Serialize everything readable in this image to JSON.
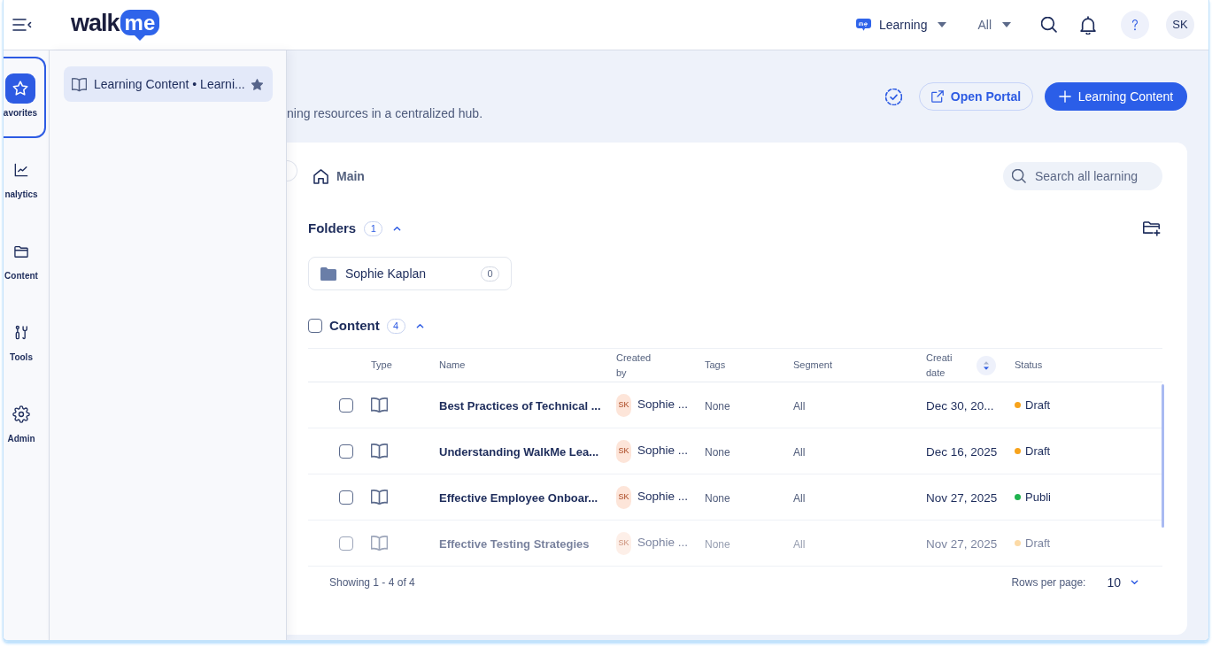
{
  "top_bar": {
    "logo": {
      "wordmark": "walk",
      "bubble": "me"
    },
    "product_menu": {
      "label": "Learning"
    },
    "scope_menu": {
      "label": "All"
    },
    "user": {
      "initials": "SK"
    }
  },
  "nav_rail": {
    "items": [
      {
        "label": "avorites",
        "selected": true
      },
      {
        "label": "nalytics",
        "selected": false
      },
      {
        "label": "Content",
        "selected": false
      },
      {
        "label": "Tools",
        "selected": false
      },
      {
        "label": "Admin",
        "selected": false
      }
    ]
  },
  "favorites_panel": {
    "items": [
      {
        "label": "Learning Content • Learni...",
        "starred": true
      }
    ]
  },
  "page_header": {
    "subtitle": "ning resources in a centralized hub.",
    "open_portal_button": "Open Portal",
    "create_button": "Learning Content"
  },
  "browser": {
    "breadcrumb": [
      {
        "label": "Main"
      }
    ],
    "search": {
      "placeholder": "Search all learning"
    },
    "folders": {
      "title": "Folders",
      "count": "1",
      "expanded": true,
      "items": [
        {
          "name": "Sophie Kaplan",
          "count": "0"
        }
      ]
    },
    "content": {
      "title": "Content",
      "count": "4",
      "expanded": true,
      "checked": false,
      "table": {
        "columns": [
          {
            "label": "Type",
            "sorted": false
          },
          {
            "label": "Name",
            "sorted": false
          },
          {
            "label": "Created by",
            "sorted": false
          },
          {
            "label": "Tags",
            "sorted": false
          },
          {
            "label": "Segment",
            "sorted": false
          },
          {
            "label": "Creati date",
            "sorted": true
          },
          {
            "label": "Status",
            "sorted": false
          }
        ],
        "rows": [
          {
            "checked": false,
            "name": "Best Practices of Technical ...",
            "creator": {
              "initials": "SK",
              "name": "Sophie ..."
            },
            "tags": "None",
            "segment": "All",
            "created": "Dec 30, 20...",
            "status": {
              "label": "Draft",
              "color": "#f7a31c"
            }
          },
          {
            "checked": false,
            "name": "Understanding WalkMe Lea...",
            "creator": {
              "initials": "SK",
              "name": "Sophie ..."
            },
            "tags": "None",
            "segment": "All",
            "created": "Dec 16, 2025",
            "status": {
              "label": "Draft",
              "color": "#f7a31c"
            }
          },
          {
            "checked": false,
            "name": "Effective Employee Onboar...",
            "creator": {
              "initials": "SK",
              "name": "Sophie ..."
            },
            "tags": "None",
            "segment": "All",
            "created": "Nov 27, 2025",
            "status": {
              "label": "Publi",
              "color": "#1fb34f"
            }
          },
          {
            "checked": false,
            "name": "Effective Testing Strategies",
            "creator": {
              "initials": "SK",
              "name": "Sophie ..."
            },
            "tags": "None",
            "segment": "All",
            "created": "Nov 27, 2025",
            "status": {
              "label": "Draft",
              "color": "#fcdaa6"
            }
          }
        ]
      },
      "footer": {
        "summary": "Showing 1 - 4 of 4",
        "rows_per_page_label": "Rows per page:",
        "rows_per_page": "10"
      }
    }
  }
}
